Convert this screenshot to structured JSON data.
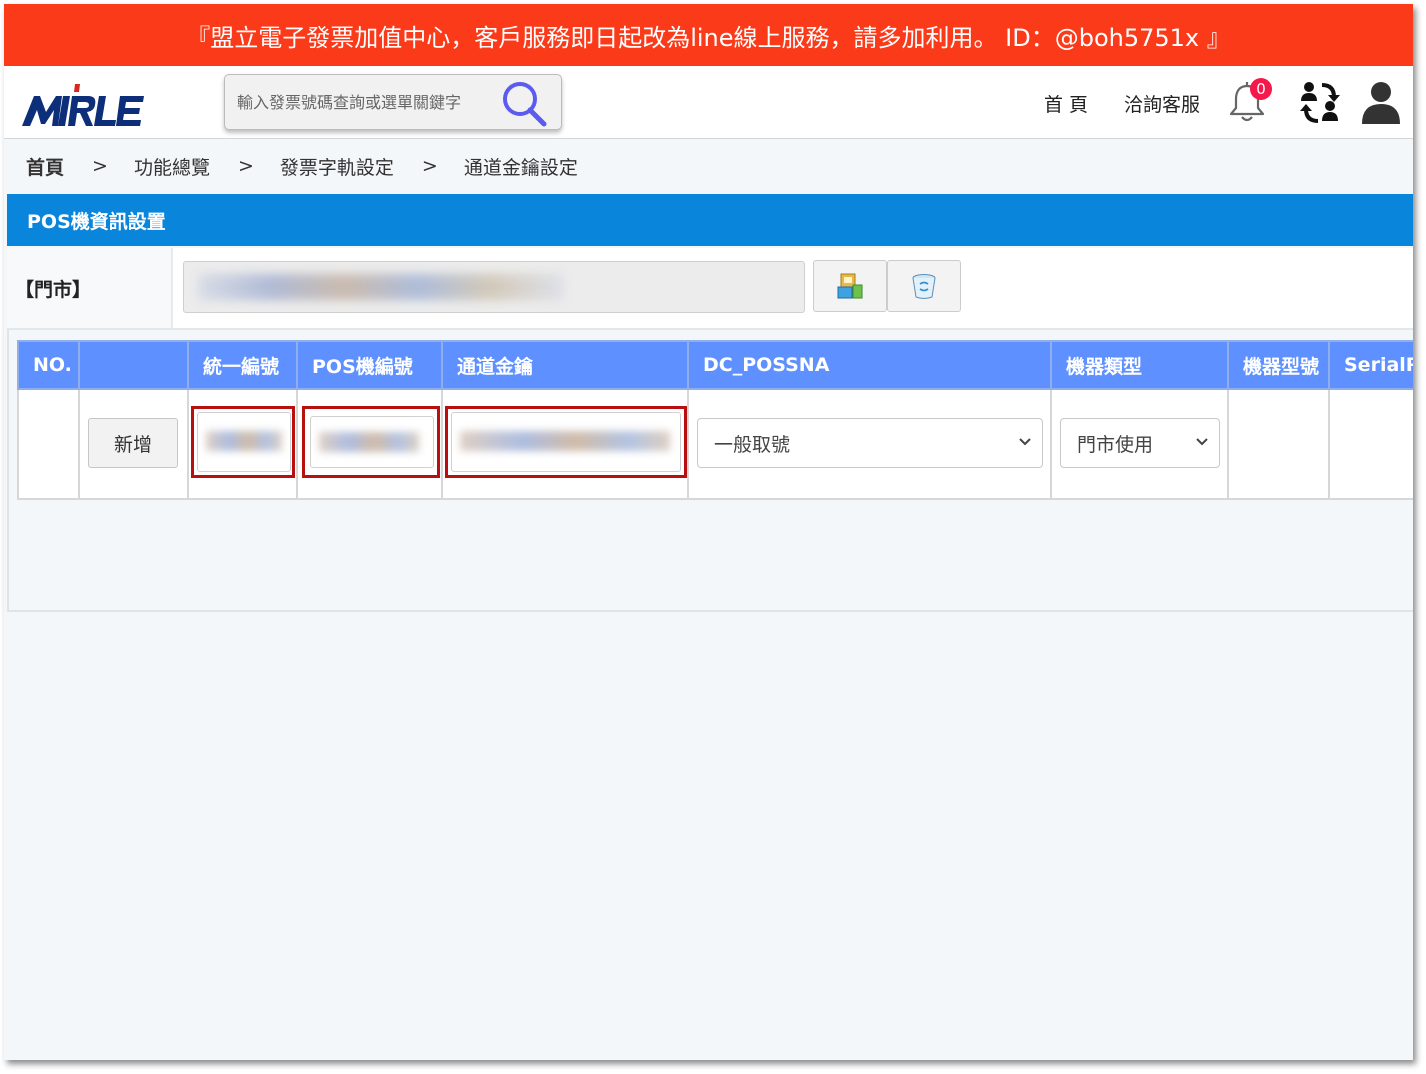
{
  "banner": {
    "text": "『盟立電子發票加值中心，客戶服務即日起改為line線上服務，請多加利用。 ID：@boh5751x 』"
  },
  "header": {
    "logo_text": "MIRLE",
    "search": {
      "placeholder": "輸入發票號碼查詢或選單關鍵字",
      "value": ""
    },
    "nav": {
      "home": "首 頁",
      "support": "洽詢客服"
    },
    "notification_count": "0",
    "icons": [
      "search-icon",
      "bell-icon",
      "swap-users-icon",
      "user-icon"
    ]
  },
  "breadcrumb": {
    "items": [
      "首頁",
      "功能總覽",
      "發票字軌設定",
      "通道金鑰設定"
    ],
    "separator": ">"
  },
  "section": {
    "title": "POS機資訊設置"
  },
  "store": {
    "label": "【門市】",
    "value": "███████████████████",
    "buttons": [
      "save-icon",
      "delete-icon"
    ]
  },
  "table": {
    "columns": [
      "NO.",
      "",
      "統一編號",
      "POS機編號",
      "通道金鑰",
      "DC_POSSNA",
      "機器類型",
      "機器型號",
      "SerialPo"
    ],
    "row": {
      "no": "",
      "add_label": "新增",
      "tax_id": "53191529",
      "pos_no": "53191529",
      "channel_key": "████████████████",
      "dc_possna": "一般取號",
      "machine_type": "門市使用",
      "machine_model": "",
      "serial": ""
    }
  },
  "colors": {
    "banner": "#fb3a1a",
    "section_bar": "#0a85dc",
    "table_header": "#5e91ff",
    "highlight_box": "#b80f0f",
    "badge": "#f5184b"
  }
}
